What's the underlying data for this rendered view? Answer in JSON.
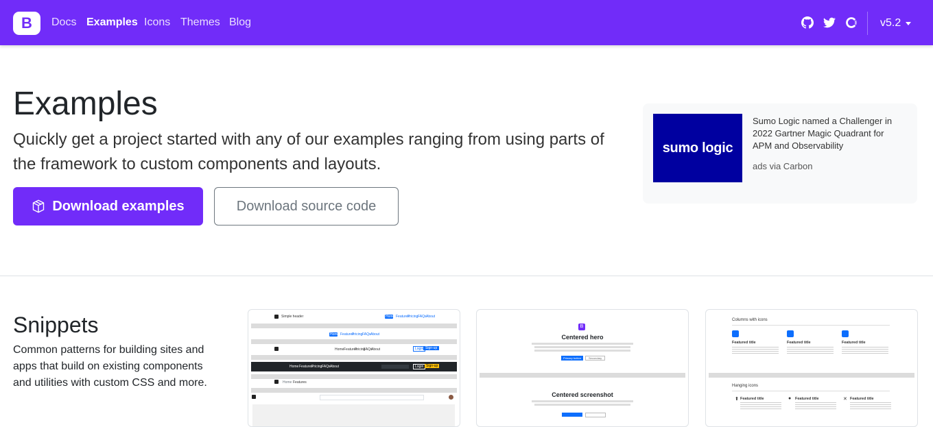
{
  "navbar": {
    "brand": "B",
    "links": [
      "Docs",
      "Examples",
      "Icons",
      "Themes",
      "Blog"
    ],
    "active_link": "Examples",
    "icons": [
      "github-icon",
      "twitter-icon",
      "opencollective-icon"
    ],
    "version": "v5.2"
  },
  "hero": {
    "title": "Examples",
    "lead": "Quickly get a project started with any of our examples ranging from using parts of the framework to custom components and layouts.",
    "primary_button": "Download examples",
    "secondary_button": "Download source code"
  },
  "ad": {
    "logo_text": "sumo logic",
    "text": "Sumo Logic named a Challenger in 2022 Gartner Magic Quadrant for APM and Observability",
    "via": "ads via Carbon"
  },
  "snippets": {
    "title": "Snippets",
    "description": "Common patterns for building sites and apps that build on existing components and utilities with custom CSS and more.",
    "cards": [
      {
        "name": "headers",
        "header1": "Simple header",
        "nav_items": [
          "Home",
          "Features",
          "Pricing",
          "FAQs",
          "About"
        ],
        "login": "Login",
        "signup": "Sign-up"
      },
      {
        "name": "heroes",
        "title1": "Centered hero",
        "title2": "Centered screenshot",
        "primary": "Primary button",
        "secondary": "Secondary"
      },
      {
        "name": "features",
        "title1": "Columns with icons",
        "title2": "Hanging icons",
        "feature": "Featured title"
      }
    ]
  },
  "colors": {
    "primary": "#712cf9",
    "ad_logo_bg": "#0000a0"
  }
}
